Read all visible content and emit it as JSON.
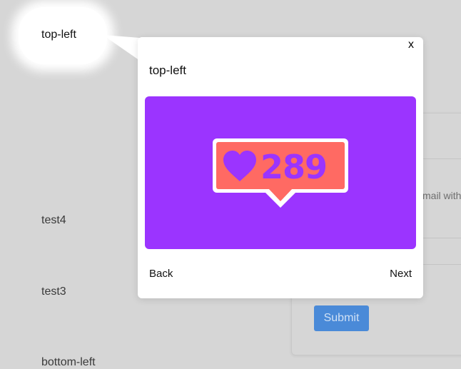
{
  "background": {
    "labels": {
      "top_left": "top-left",
      "test4": "test4",
      "test3": "test3",
      "bottom_left": "bottom-left"
    },
    "form": {
      "hint_fragment": "mail with",
      "submit_label": "Submit"
    }
  },
  "popover": {
    "close_label": "x",
    "title": "top-left",
    "media": {
      "like_count": "289",
      "background_color": "#9b34ff",
      "badge_color": "#ff6a63",
      "icon": "heart-icon"
    },
    "back_label": "Back",
    "next_label": "Next"
  }
}
